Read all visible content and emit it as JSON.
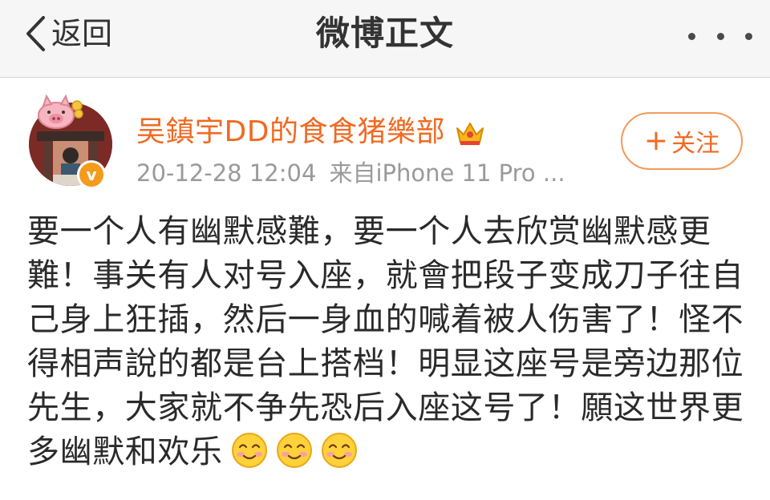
{
  "header": {
    "back_label": "返回",
    "title": "微博正文"
  },
  "post": {
    "author": {
      "name": "吴鎮宇DD的食食猪樂部",
      "verified_badge": "v"
    },
    "timestamp": "20-12-28 12:04",
    "source": "来自iPhone 11 Pro ...",
    "follow_label": "关注",
    "follow_plus": "+",
    "content_lines": [
      "要一个人有幽默感難，要一个人去欣赏幽默感更",
      "難！事关有人对号入座，就會把段子变成刀子往自",
      "己身上狂插，然后一身血的喊着被人伤害了！怪不",
      "得相声說的都是台上搭档！明显这座号是旁边那位",
      "先生，大家就不争先恐后入座这号了！願这世界更",
      "多幽默和欢乐"
    ],
    "trailing_emojis": [
      "smile-emoji",
      "smile-emoji",
      "smile-emoji"
    ]
  },
  "colors": {
    "accent_orange": "#f06a22",
    "badge_orange": "#f49a1c",
    "topbar_bg": "#f6f6f6",
    "meta_gray": "#9a9a9a"
  },
  "icons": {
    "back": "chevron-left-icon",
    "more": "more-dots-icon",
    "crown": "crown-icon",
    "verified": "verified-v-icon"
  }
}
